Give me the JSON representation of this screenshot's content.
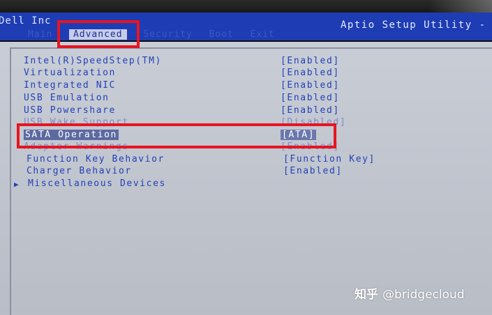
{
  "header": {
    "vendor": "Dell Inc",
    "utility_title": "Aptio Setup Utility -"
  },
  "tabs": [
    {
      "label": "Main",
      "active": false
    },
    {
      "label": "Advanced",
      "active": true
    },
    {
      "label": "Security",
      "active": false
    },
    {
      "label": "Boot",
      "active": false
    },
    {
      "label": "Exit",
      "active": false
    }
  ],
  "settings": [
    {
      "label": "Intel(R)SpeedStep(TM)",
      "value": "[Enabled]"
    },
    {
      "label": "Virtualization",
      "value": "[Enabled]"
    },
    {
      "label": "Integrated NIC",
      "value": "[Enabled]"
    },
    {
      "label": "USB Emulation",
      "value": "[Enabled]"
    },
    {
      "label": "USB Powershare",
      "value": "[Enabled]"
    },
    {
      "label": "USB Wake Support",
      "value": "[Disabled]"
    },
    {
      "label": "SATA Operation",
      "value": "[ATA]"
    },
    {
      "label": "Adapter Warnings",
      "value": "[Enabled]"
    },
    {
      "label": "Function Key Behavior",
      "value": "[Function Key]"
    },
    {
      "label": "Charger Behavior",
      "value": "[Enabled]"
    },
    {
      "label": "Miscellaneous Devices",
      "value": ""
    }
  ],
  "watermark": {
    "site": "知乎",
    "handle": "@bridgecloud"
  },
  "colors": {
    "header_bg": "#1e3db4",
    "body_bg": "#c9cdd6",
    "item_text": "#2242b8",
    "highlight_box": "#e8141f"
  }
}
